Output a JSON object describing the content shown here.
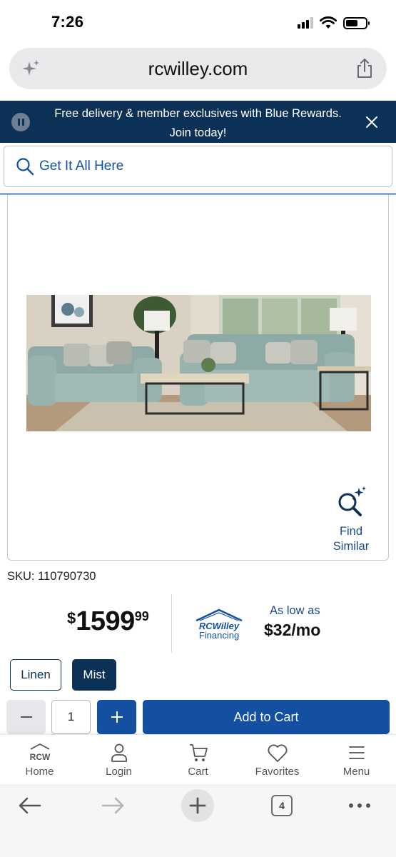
{
  "status_bar": {
    "time": "7:26"
  },
  "browser": {
    "url": "rcwilley.com",
    "tab_count": "4"
  },
  "promo": {
    "text": "Free delivery & member exclusives with Blue Rewards. Join today!"
  },
  "search": {
    "placeholder": "Get It All Here"
  },
  "product": {
    "find_similar_label": "Find Similar",
    "sku": "SKU: 110790730",
    "price": {
      "dollar": "$",
      "whole": "1599",
      "cents": "99"
    },
    "financing": {
      "brand_line1": "RCWilley",
      "brand_line2": "Financing",
      "as_low_as": "As low as",
      "monthly": "$32/mo"
    },
    "colors": [
      {
        "label": "Linen",
        "selected": false
      },
      {
        "label": "Mist",
        "selected": true
      }
    ],
    "quantity": "1",
    "minus_label": "−",
    "plus_label": "+",
    "add_to_cart_label": "Add to Cart"
  },
  "site_nav": {
    "items": [
      {
        "label": "Home",
        "icon": "rcw-home-icon"
      },
      {
        "label": "Login",
        "icon": "user-icon"
      },
      {
        "label": "Cart",
        "icon": "cart-icon"
      },
      {
        "label": "Favorites",
        "icon": "heart-icon"
      },
      {
        "label": "Menu",
        "icon": "hamburger-icon"
      }
    ],
    "home_logo_text": "RCW"
  },
  "colors": {
    "brand_navy": "#0c3157",
    "brand_blue": "#1350a1",
    "link_blue": "#1a4c8c"
  }
}
